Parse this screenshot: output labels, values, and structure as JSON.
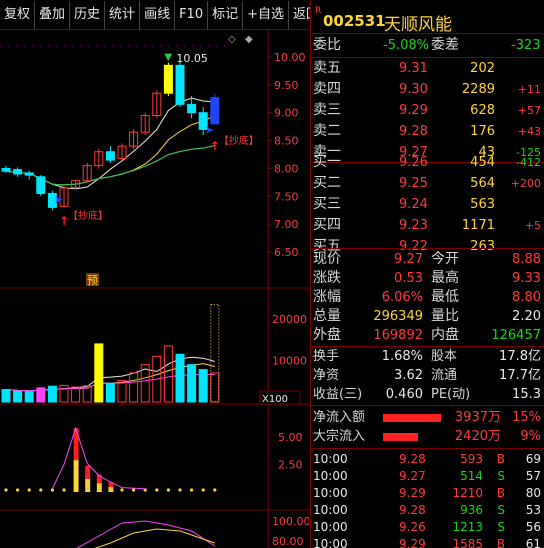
{
  "toolbar": {
    "items": [
      "复权",
      "叠加",
      "历史",
      "统计",
      "画线",
      "F10",
      "标记",
      "+自选",
      "返回"
    ]
  },
  "chart": {
    "price_ticks": [
      "10.00",
      "9.50",
      "9.00",
      "8.50",
      "8.00",
      "7.50",
      "7.00",
      "6.50"
    ],
    "vol_ticks": [
      "20000",
      "10000"
    ],
    "vol_unit": "X100",
    "ind_ticks": [
      "5.00",
      "2.50"
    ],
    "osc_ticks": [
      "100.00",
      "80.00"
    ],
    "high_label": "10.05",
    "signal_label": "抄底",
    "flag_label": "预",
    "colors": {
      "up": "#ff3b3b",
      "down": "#00e5ff",
      "ma_white": "#e8e8e8",
      "ma_yellow": "#ffd43b",
      "ma_magenta": "#ff44ff",
      "ma_green": "#2ecc40",
      "limit_up": "#ffff00",
      "blue_candle": "#2244ff"
    }
  },
  "chart_data": {
    "type": "candlestick",
    "candles": [
      {
        "o": 8.0,
        "h": 8.05,
        "l": 7.92,
        "c": 7.95
      },
      {
        "o": 7.98,
        "h": 8.02,
        "l": 7.85,
        "c": 7.9
      },
      {
        "o": 7.92,
        "h": 7.96,
        "l": 7.8,
        "c": 7.88
      },
      {
        "o": 7.85,
        "h": 7.88,
        "l": 7.5,
        "c": 7.55
      },
      {
        "o": 7.55,
        "h": 7.6,
        "l": 7.25,
        "c": 7.3
      },
      {
        "o": 7.32,
        "h": 7.68,
        "l": 7.3,
        "c": 7.65
      },
      {
        "o": 7.66,
        "h": 7.8,
        "l": 7.62,
        "c": 7.78
      },
      {
        "o": 7.78,
        "h": 8.1,
        "l": 7.75,
        "c": 8.05
      },
      {
        "o": 8.05,
        "h": 8.35,
        "l": 8.0,
        "c": 8.3
      },
      {
        "o": 8.3,
        "h": 8.4,
        "l": 8.1,
        "c": 8.15
      },
      {
        "o": 8.18,
        "h": 8.45,
        "l": 8.15,
        "c": 8.4
      },
      {
        "o": 8.4,
        "h": 8.7,
        "l": 8.35,
        "c": 8.65
      },
      {
        "o": 8.65,
        "h": 9.0,
        "l": 8.6,
        "c": 8.95
      },
      {
        "o": 8.95,
        "h": 9.4,
        "l": 8.9,
        "c": 9.35
      },
      {
        "o": 9.35,
        "h": 9.9,
        "l": 9.3,
        "c": 9.85
      },
      {
        "o": 9.85,
        "h": 10.05,
        "l": 9.1,
        "c": 9.15
      },
      {
        "o": 9.15,
        "h": 9.3,
        "l": 8.9,
        "c": 9.0
      },
      {
        "o": 9.0,
        "h": 9.1,
        "l": 8.6,
        "c": 8.7
      },
      {
        "o": 8.8,
        "h": 9.33,
        "l": 8.8,
        "c": 9.27
      }
    ],
    "volume": [
      3000,
      2600,
      2400,
      3400,
      3800,
      4000,
      3600,
      3900,
      14000,
      4500,
      5200,
      7000,
      9000,
      11000,
      13500,
      11500,
      9000,
      7800,
      7000
    ],
    "indicator": [
      0.3,
      0.3,
      0.3,
      0.3,
      0.3,
      0.3,
      5.8,
      2.4,
      1.6,
      0.9,
      0.5,
      0.3,
      0.3,
      0.3,
      0.3,
      0.3,
      0.3,
      0.3,
      0.3
    ]
  },
  "quote": {
    "r_mark": "R",
    "code": "002531",
    "name": "天顺风能",
    "weibi": {
      "label": "委比",
      "value": "-5.08%",
      "label2": "委差",
      "value2": "-323"
    },
    "sells": [
      {
        "label": "卖五",
        "price": "9.31",
        "vol": "202",
        "chg": ""
      },
      {
        "label": "卖四",
        "price": "9.30",
        "vol": "2289",
        "chg": "+11"
      },
      {
        "label": "卖三",
        "price": "9.29",
        "vol": "628",
        "chg": "+57"
      },
      {
        "label": "卖二",
        "price": "9.28",
        "vol": "176",
        "chg": "+43"
      },
      {
        "label": "卖一",
        "price": "9.27",
        "vol": "43",
        "chg": "-125"
      }
    ],
    "buys": [
      {
        "label": "买一",
        "price": "9.26",
        "vol": "454",
        "chg": "-412"
      },
      {
        "label": "买二",
        "price": "9.25",
        "vol": "564",
        "chg": "+200"
      },
      {
        "label": "买三",
        "price": "9.24",
        "vol": "563",
        "chg": ""
      },
      {
        "label": "买四",
        "price": "9.23",
        "vol": "1171",
        "chg": "+5"
      },
      {
        "label": "买五",
        "price": "9.22",
        "vol": "263",
        "chg": ""
      }
    ],
    "stats": [
      {
        "l1": "现价",
        "v1": "9.27",
        "l2": "今开",
        "v2": "8.88"
      },
      {
        "l1": "涨跌",
        "v1": "0.53",
        "l2": "最高",
        "v2": "9.33"
      },
      {
        "l1": "涨幅",
        "v1": "6.06%",
        "l2": "最低",
        "v2": "8.80"
      },
      {
        "l1": "总量",
        "v1": "296349",
        "l2": "量比",
        "v2": "2.20"
      },
      {
        "l1": "外盘",
        "v1": "169892",
        "l2": "内盘",
        "v2": "126457"
      }
    ],
    "stats2": [
      {
        "l1": "换手",
        "v1": "1.68%",
        "l2": "股本",
        "v2": "17.8亿"
      },
      {
        "l1": "净资",
        "v1": "3.62",
        "l2": "流通",
        "v2": "17.7亿"
      },
      {
        "l1": "收益(三)",
        "v1": "0.460",
        "l2": "PE(动)",
        "v2": "15.3"
      }
    ],
    "flows": [
      {
        "label": "净流入额",
        "value": "3937万",
        "pct": "15%",
        "bar": 0.85
      },
      {
        "label": "大宗流入",
        "value": "2420万",
        "pct": "9%",
        "bar": 0.52
      }
    ],
    "trades": [
      {
        "time": "10:00",
        "price": "9.28",
        "vol": "593",
        "side": "B",
        "n": "69"
      },
      {
        "time": "10:00",
        "price": "9.27",
        "vol": "514",
        "side": "S",
        "n": "57"
      },
      {
        "time": "10:00",
        "price": "9.29",
        "vol": "1210",
        "side": "B",
        "n": "80"
      },
      {
        "time": "10:00",
        "price": "9.28",
        "vol": "936",
        "side": "S",
        "n": "53"
      },
      {
        "time": "10:00",
        "price": "9.26",
        "vol": "1213",
        "side": "S",
        "n": "56"
      },
      {
        "time": "10:00",
        "price": "9.29",
        "vol": "1585",
        "side": "B",
        "n": "61"
      }
    ]
  }
}
